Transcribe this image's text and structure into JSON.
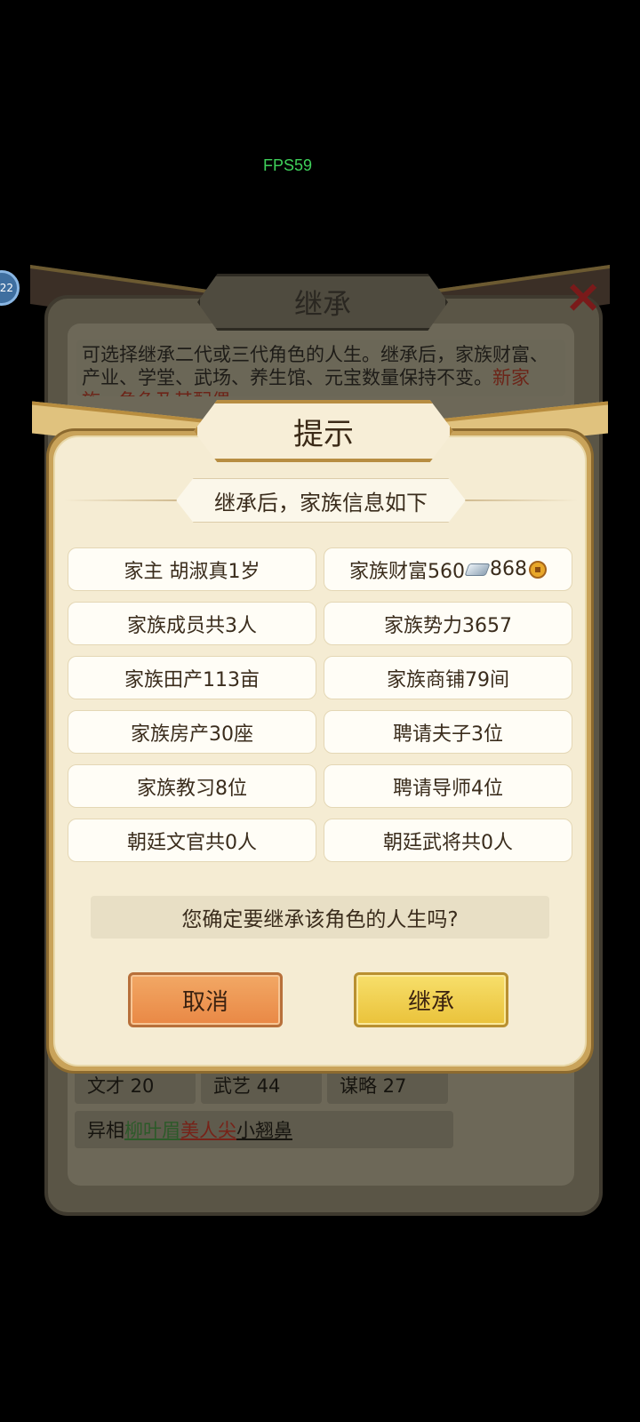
{
  "fps": "FPS59",
  "avatar_badge": "22",
  "background": {
    "title": "继承",
    "description_normal": "可选择继承二代或三代角色的人生。继承后，家族财富、产业、学堂、武场、养生馆、元宝数量保持不变。",
    "description_red": "新家族...角色及其配偶",
    "stats": [
      {
        "label": "文才 20"
      },
      {
        "label": "武艺 44"
      },
      {
        "label": "谋略 27"
      }
    ],
    "traits": {
      "prefix": "异相",
      "t1": "柳叶眉",
      "t2": "美人尖",
      "t3": "小翘鼻"
    },
    "close_mark": "X"
  },
  "dialog": {
    "title": "提示",
    "subtitle": "继承后，家族信息如下",
    "info": {
      "head": "家主 胡淑真1岁",
      "wealth_prefix": "家族财富560",
      "wealth_mid": "868",
      "members": "家族成员共3人",
      "power": "家族势力3657",
      "fields": "家族田产113亩",
      "shops": "家族商铺79间",
      "houses": "家族房产30座",
      "tutors": "聘请夫子3位",
      "trainers": "家族教习8位",
      "mentors": "聘请导师4位",
      "civil": "朝廷文官共0人",
      "military": "朝廷武将共0人"
    },
    "confirm_text": "您确定要继承该角色的人生吗?",
    "cancel_label": "取消",
    "inherit_label": "继承"
  }
}
